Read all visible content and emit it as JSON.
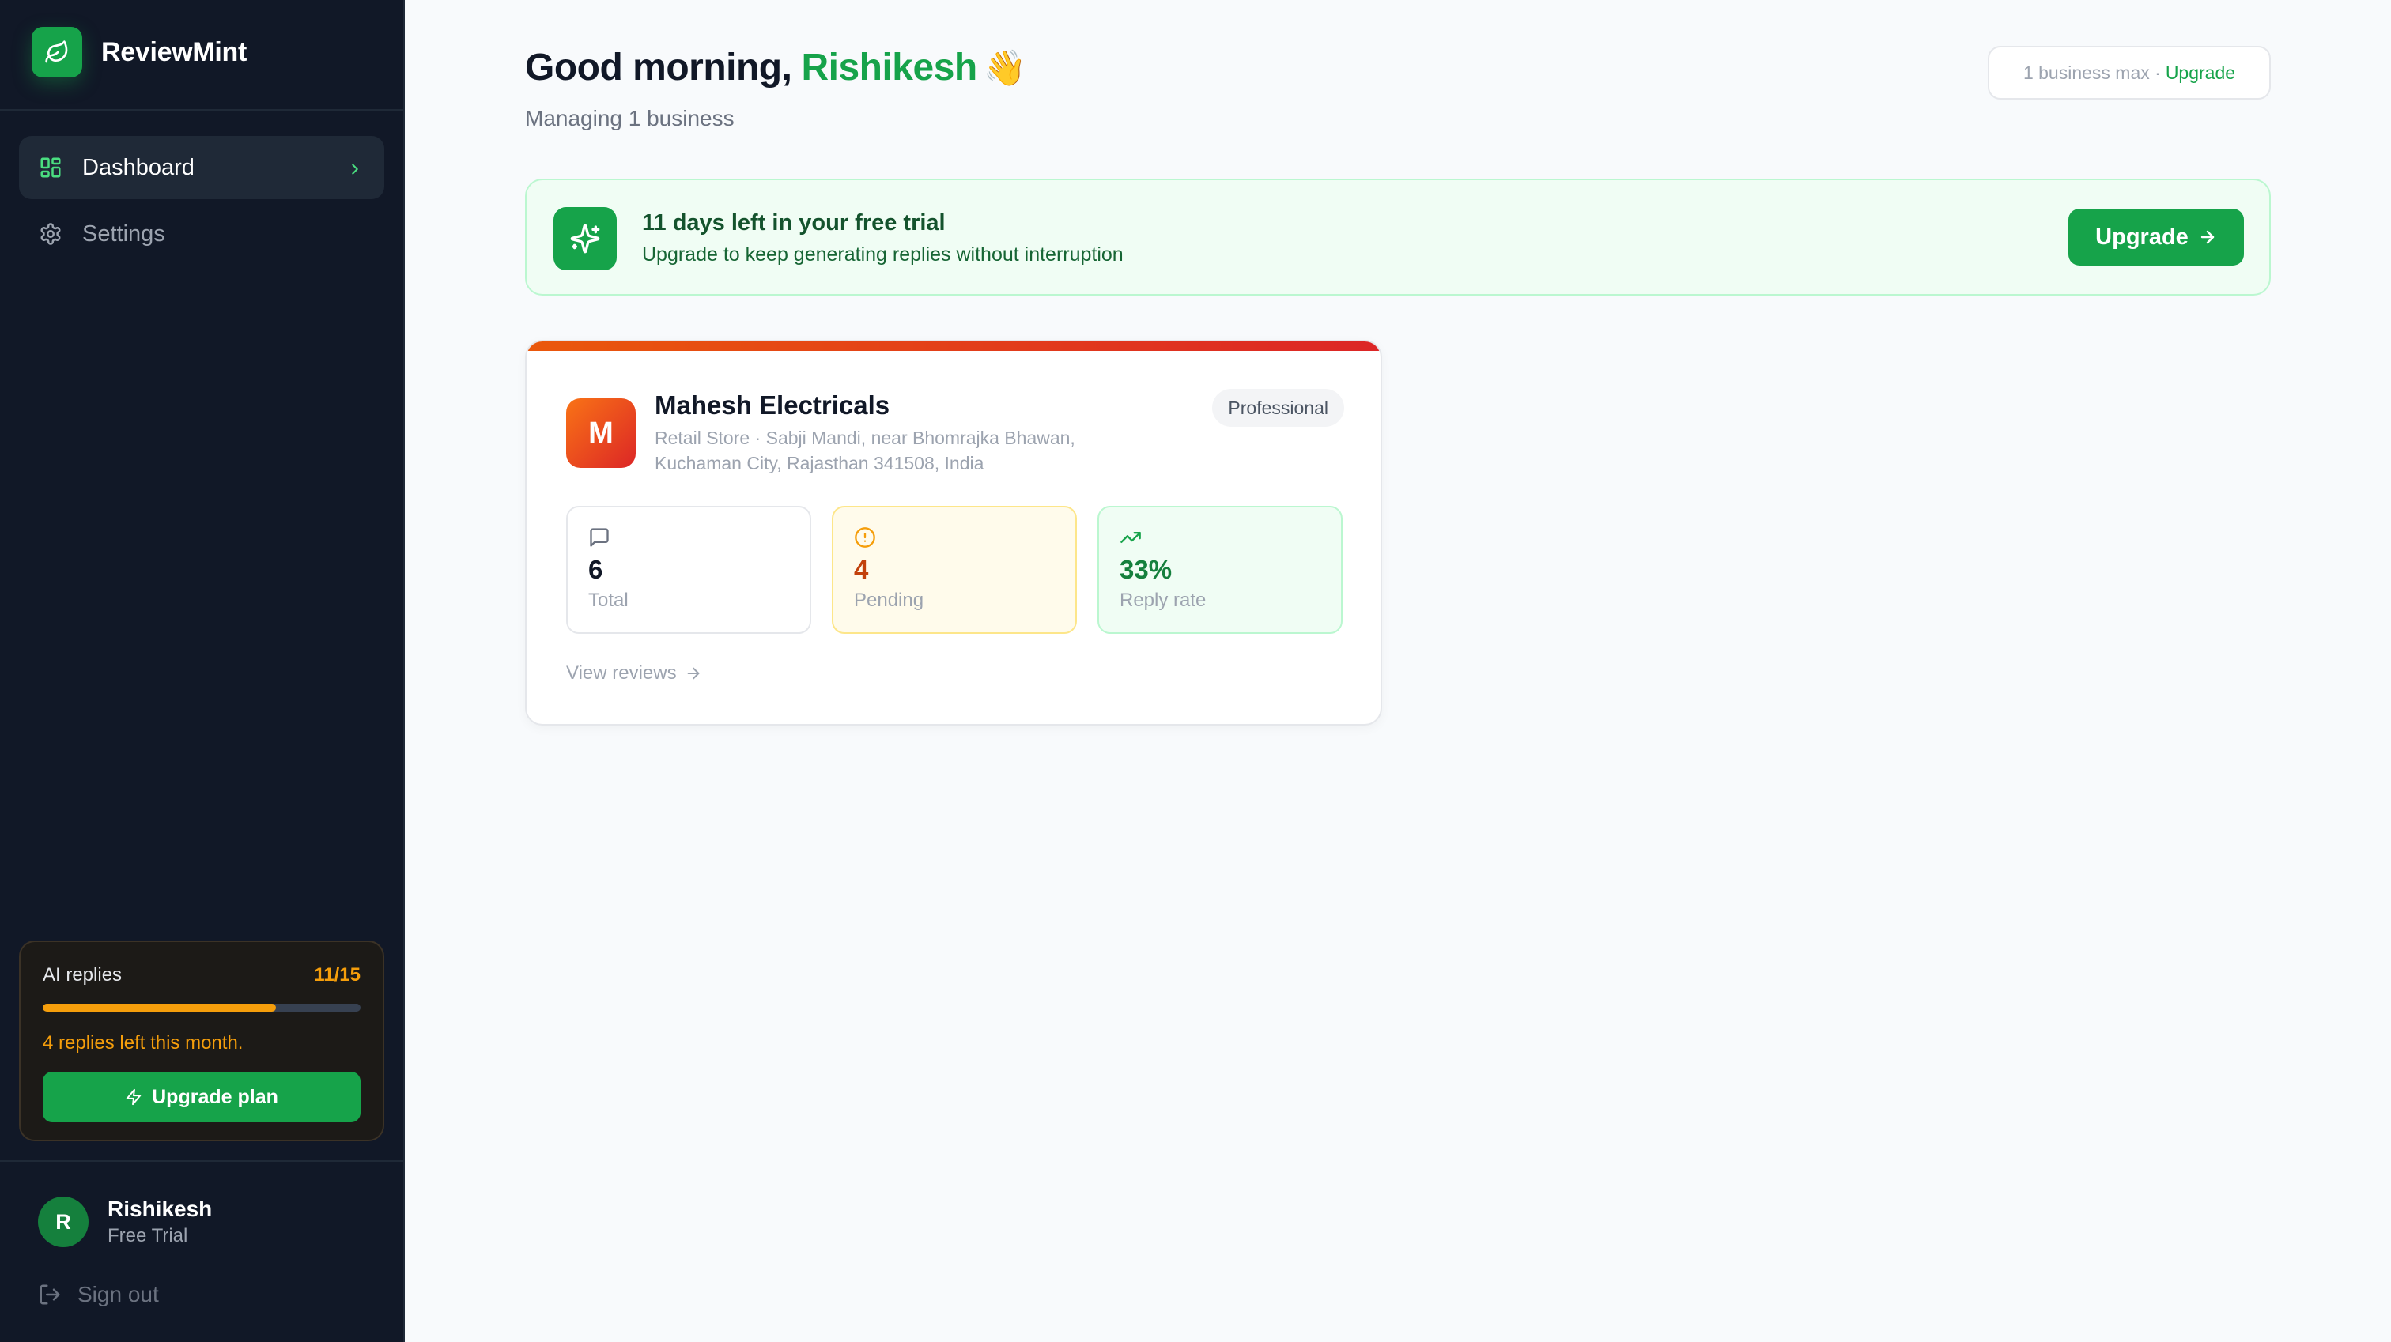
{
  "brand": {
    "name": "ReviewMint",
    "accent": "#16a34a"
  },
  "sidebar": {
    "nav": [
      {
        "label": "Dashboard",
        "icon": "dashboard-grid-icon",
        "active": true
      },
      {
        "label": "Settings",
        "icon": "gear-icon",
        "active": false
      }
    ],
    "quota": {
      "label": "AI replies",
      "count": "11/15",
      "used": 11,
      "total": 15,
      "note": "4 replies left this month.",
      "button": "Upgrade plan"
    },
    "user": {
      "initial": "R",
      "name": "Rishikesh",
      "plan": "Free Trial"
    },
    "signout": "Sign out"
  },
  "header": {
    "greeting": "Good morning,",
    "name": "Rishikesh",
    "emoji": "👋",
    "subtitle": "Managing 1 business",
    "limit_text": "1 business max ·",
    "limit_link": "Upgrade"
  },
  "trial": {
    "title": "11 days left in your free trial",
    "subtitle": "Upgrade to keep generating replies without interruption",
    "button": "Upgrade"
  },
  "business": {
    "initial": "M",
    "name": "Mahesh Electricals",
    "address": "Retail Store · Sabji Mandi, near Bhomrajka Bhawan, Kuchaman City, Rajasthan 341508, India",
    "plan": "Professional",
    "stats": [
      {
        "value": "6",
        "label": "Total",
        "icon": "message-icon"
      },
      {
        "value": "4",
        "label": "Pending",
        "icon": "alert-circle-icon"
      },
      {
        "value": "33%",
        "label": "Reply rate",
        "icon": "trending-up-icon"
      }
    ],
    "link": "View reviews"
  }
}
